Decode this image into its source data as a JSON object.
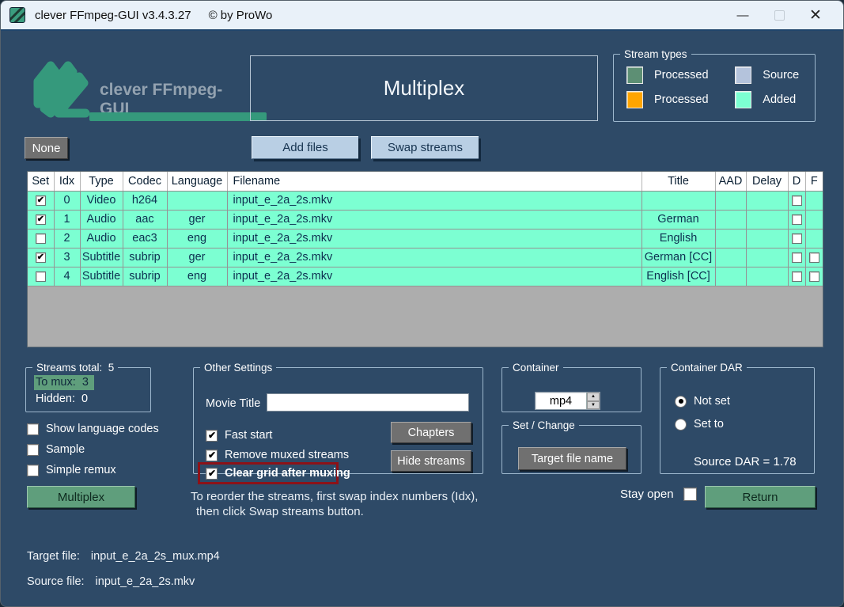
{
  "window": {
    "title": "clever FFmpeg-GUI v3.4.3.27",
    "copyright": "© by ProWo",
    "minimize": "—",
    "close": "✕"
  },
  "header": {
    "title": "Multiplex"
  },
  "legend": {
    "title": "Stream types",
    "items": [
      {
        "label": "Processed",
        "color": "#5d8f74"
      },
      {
        "label": "Source",
        "color": "#b4c3dc"
      },
      {
        "label": "Processed",
        "color": "#ffa500"
      },
      {
        "label": "Added",
        "color": "#7cffd2"
      }
    ]
  },
  "toolbar": {
    "none_label": "None",
    "add_files_label": "Add files",
    "swap_streams_label": "Swap streams"
  },
  "table": {
    "columns": [
      "Set",
      "Idx",
      "Type",
      "Codec",
      "Language",
      "Filename",
      "Title",
      "AAD",
      "Delay",
      "D",
      "F"
    ],
    "rows": [
      {
        "set": true,
        "idx": "0",
        "type": "Video",
        "codec": "h264",
        "language": "",
        "filename": "input_e_2a_2s.mkv",
        "title": "",
        "aad": "",
        "delay": "",
        "d": false,
        "f": null
      },
      {
        "set": true,
        "idx": "1",
        "type": "Audio",
        "codec": "aac",
        "language": "ger",
        "filename": "input_e_2a_2s.mkv",
        "title": "German",
        "aad": "",
        "delay": "",
        "d": false,
        "f": null
      },
      {
        "set": false,
        "idx": "2",
        "type": "Audio",
        "codec": "eac3",
        "language": "eng",
        "filename": "input_e_2a_2s.mkv",
        "title": "English",
        "aad": "",
        "delay": "",
        "d": false,
        "f": null
      },
      {
        "set": true,
        "idx": "3",
        "type": "Subtitle",
        "codec": "subrip",
        "language": "ger",
        "filename": "input_e_2a_2s.mkv",
        "title": "German [CC]",
        "aad": "",
        "delay": "",
        "d": false,
        "f": false
      },
      {
        "set": false,
        "idx": "4",
        "type": "Subtitle",
        "codec": "subrip",
        "language": "eng",
        "filename": "input_e_2a_2s.mkv",
        "title": "English [CC]",
        "aad": "",
        "delay": "",
        "d": false,
        "f": false
      }
    ]
  },
  "stats": {
    "total_label": "Streams total:",
    "total_value": "5",
    "to_mux_label": "To mux:",
    "to_mux_value": "3",
    "hidden_label": "Hidden:",
    "hidden_value": "0"
  },
  "options": {
    "show_language_codes": "Show language codes",
    "sample": "Sample",
    "simple_remux": "Simple remux",
    "multiplex_label": "Multiplex"
  },
  "other_settings": {
    "title": "Other Settings",
    "movie_title_label": "Movie Title",
    "movie_title_value": "",
    "fast_start": "Fast start",
    "remove_muxed": "Remove muxed streams",
    "clear_grid": "Clear grid after muxing",
    "chapters_label": "Chapters",
    "hide_streams_label": "Hide streams"
  },
  "container_group": {
    "title": "Container",
    "value": "mp4",
    "spin_up": "▲",
    "spin_down": "▼"
  },
  "set_change": {
    "title": "Set / Change",
    "target_file_name_label": "Target file name"
  },
  "container_dar": {
    "title": "Container DAR",
    "not_set": "Not set",
    "set_to": "Set to",
    "source_dar": "Source DAR = 1.78"
  },
  "footer": {
    "hint_line1": "To reorder the streams, first swap index numbers (Idx),",
    "hint_line2": "then click Swap streams button.",
    "stay_open": "Stay open",
    "return_label": "Return",
    "target_file_label": "Target file:",
    "target_file_value": "input_e_2a_2s_mux.mp4",
    "source_file_label": "Source file:",
    "source_file_value": "input_e_2a_2s.mkv"
  },
  "colors": {
    "background": "#2e4a67",
    "row_added_mint": "#7cffd2",
    "accent_green": "#5f9e7c",
    "logo_green": "#35997c",
    "highlight_red": "#8c1218"
  }
}
